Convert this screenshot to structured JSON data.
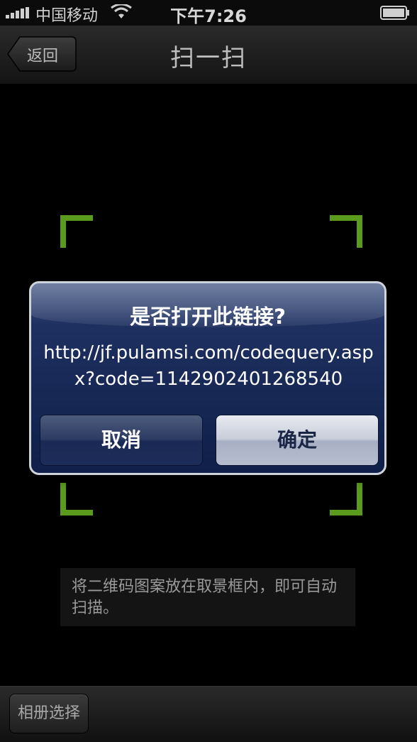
{
  "status_bar": {
    "carrier": "中国移动",
    "time": "下午7:26",
    "icons": [
      "signal-icon",
      "wifi-icon",
      "battery-icon"
    ]
  },
  "nav": {
    "back_label": "返回",
    "title": "扫一扫"
  },
  "alert": {
    "title": "是否打开此链接?",
    "message": "http://jf.pulamsi.com/codequery.aspx?code=1142902401268540",
    "cancel_label": "取消",
    "confirm_label": "确定"
  },
  "hint": {
    "text": "将二维码图案放在取景框内，即可自动扫描。"
  },
  "toolbar": {
    "album_label": "相册选择"
  },
  "colors": {
    "scan_corner": "#5a9a1c",
    "alert_bg": "#1e3060",
    "background": "#000000"
  }
}
